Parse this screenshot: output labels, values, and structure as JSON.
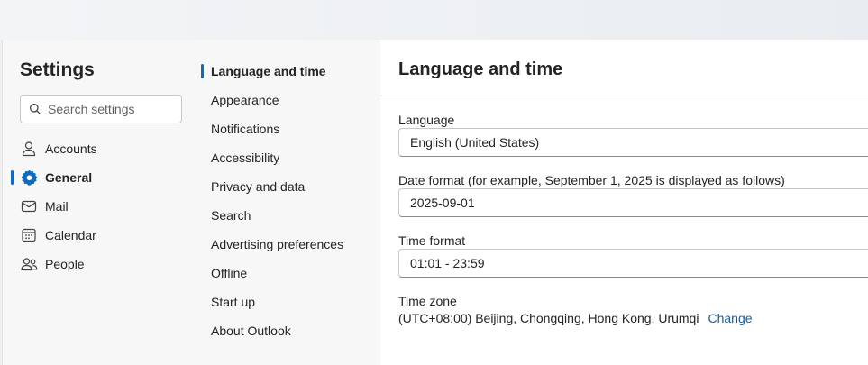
{
  "settings": {
    "title": "Settings",
    "search_placeholder": "Search settings"
  },
  "nav": {
    "items": [
      {
        "label": "Accounts",
        "icon": "person-icon"
      },
      {
        "label": "General",
        "icon": "gear-icon",
        "active": true
      },
      {
        "label": "Mail",
        "icon": "mail-icon"
      },
      {
        "label": "Calendar",
        "icon": "calendar-icon"
      },
      {
        "label": "People",
        "icon": "people-icon"
      }
    ]
  },
  "subnav": {
    "items": [
      {
        "label": "Language and time",
        "active": true
      },
      {
        "label": "Appearance"
      },
      {
        "label": "Notifications"
      },
      {
        "label": "Accessibility"
      },
      {
        "label": "Privacy and data"
      },
      {
        "label": "Search"
      },
      {
        "label": "Advertising preferences"
      },
      {
        "label": "Offline"
      },
      {
        "label": "Start up"
      },
      {
        "label": "About Outlook"
      }
    ]
  },
  "content": {
    "title": "Language and time",
    "language": {
      "label": "Language",
      "value": "English (United States)"
    },
    "date_format": {
      "label": "Date format (for example, September 1, 2025 is displayed as follows)",
      "value": "2025-09-01"
    },
    "time_format": {
      "label": "Time format",
      "value": "01:01 - 23:59"
    },
    "time_zone": {
      "label": "Time zone",
      "value": "(UTC+08:00) Beijing, Chongqing, Hong Kong, Urumqi",
      "change_link": "Change"
    }
  },
  "colors": {
    "accent": "#0f6cbd",
    "link": "#115ea3",
    "general_icon": "#0f6cbd"
  }
}
